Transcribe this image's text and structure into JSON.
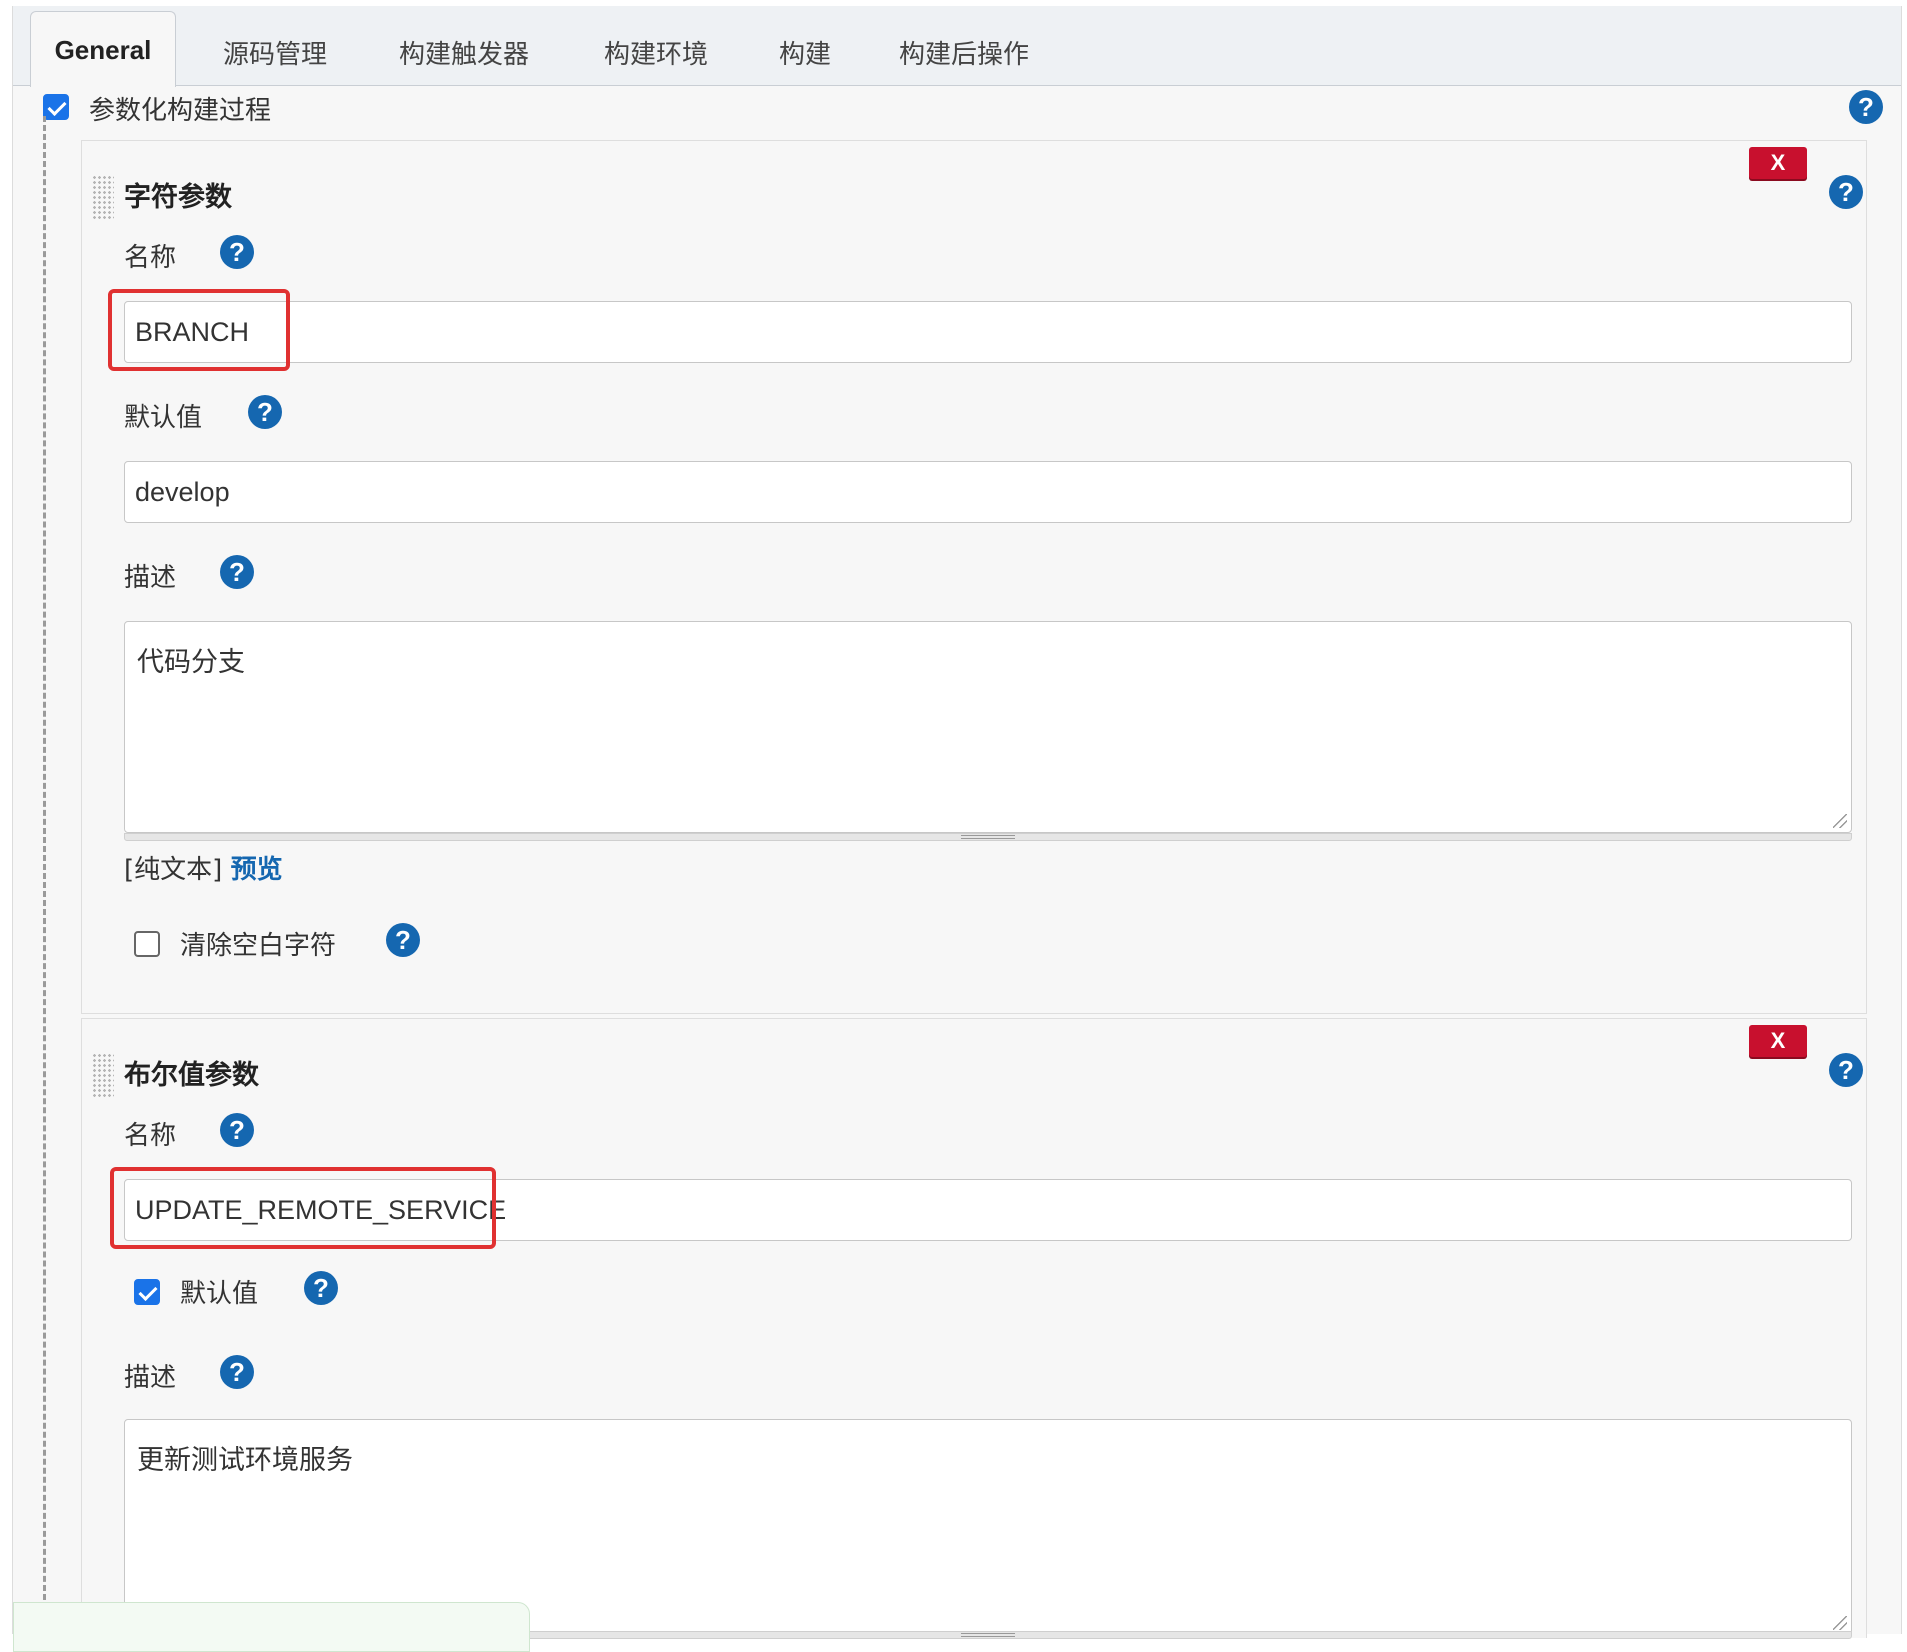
{
  "tabs": [
    {
      "label": "General",
      "active": true
    },
    {
      "label": "源码管理"
    },
    {
      "label": "构建触发器"
    },
    {
      "label": "构建环境"
    },
    {
      "label": "构建"
    },
    {
      "label": "构建后操作"
    }
  ],
  "parameterized": {
    "label": "参数化构建过程",
    "checked": true,
    "help": "?"
  },
  "string_param": {
    "title": "字符参数",
    "delete": "X",
    "help": "?",
    "name_label": "名称",
    "name_value": "BRANCH",
    "default_label": "默认值",
    "default_value": "develop",
    "desc_label": "描述",
    "desc_value": "代码分支",
    "format_text": "[纯文本]",
    "preview_link": "预览",
    "trim_label": "清除空白字符",
    "trim_checked": false
  },
  "bool_param": {
    "title": "布尔值参数",
    "delete": "X",
    "help": "?",
    "name_label": "名称",
    "name_value": "UPDATE_REMOTE_SERVICE",
    "default_label": "默认值",
    "default_checked": true,
    "desc_label": "描述",
    "desc_value": "更新测试环境服务"
  }
}
